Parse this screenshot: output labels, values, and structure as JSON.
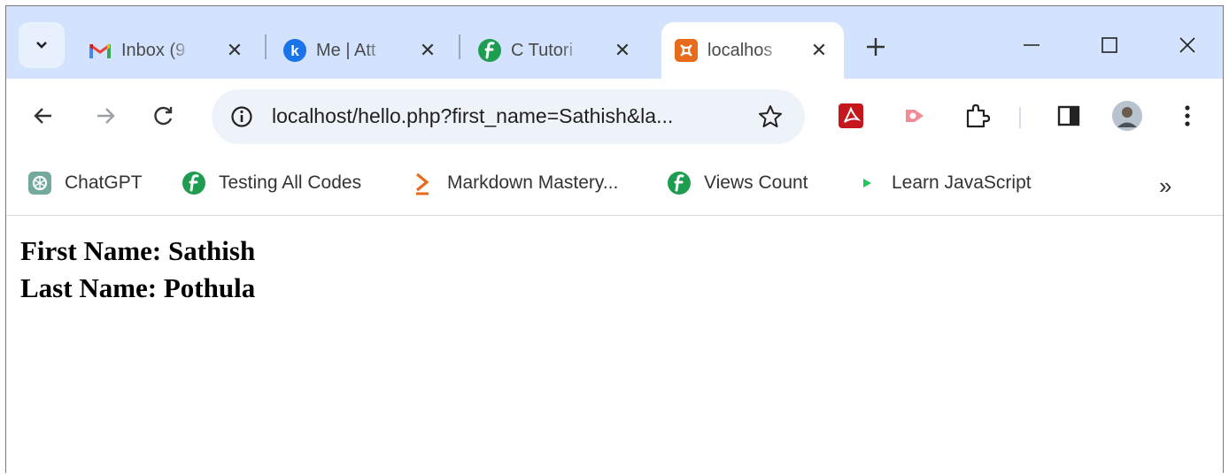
{
  "tabs": [
    {
      "title": "Inbox (9",
      "favicon": "gmail-icon"
    },
    {
      "title": "Me | Att",
      "favicon": "k-icon"
    },
    {
      "title": "C Tutori",
      "favicon": "fp-icon"
    },
    {
      "title": "localhos",
      "favicon": "xampp-icon",
      "active": true
    }
  ],
  "omnibox": {
    "url": "localhost/hello.php?first_name=Sathish&la..."
  },
  "bookmarks": [
    {
      "label": "ChatGPT",
      "icon": "chatgpt-icon"
    },
    {
      "label": "Testing All Codes",
      "icon": "fp-icon"
    },
    {
      "label": "Markdown Mastery...",
      "icon": "chevron-right-icon"
    },
    {
      "label": "Views Count",
      "icon": "fp-icon"
    },
    {
      "label": "Learn JavaScript",
      "icon": "play-icon"
    }
  ],
  "bookmarks_more": "»",
  "page": {
    "first_name_line": "First Name: Sathish",
    "last_name_line": "Last Name: Pothula"
  },
  "colors": {
    "tabstrip_bg": "#d3e3fd",
    "omnibox_bg": "#eef3f9",
    "fp_green": "#1e9c4f",
    "xampp_orange": "#e86b1c"
  }
}
